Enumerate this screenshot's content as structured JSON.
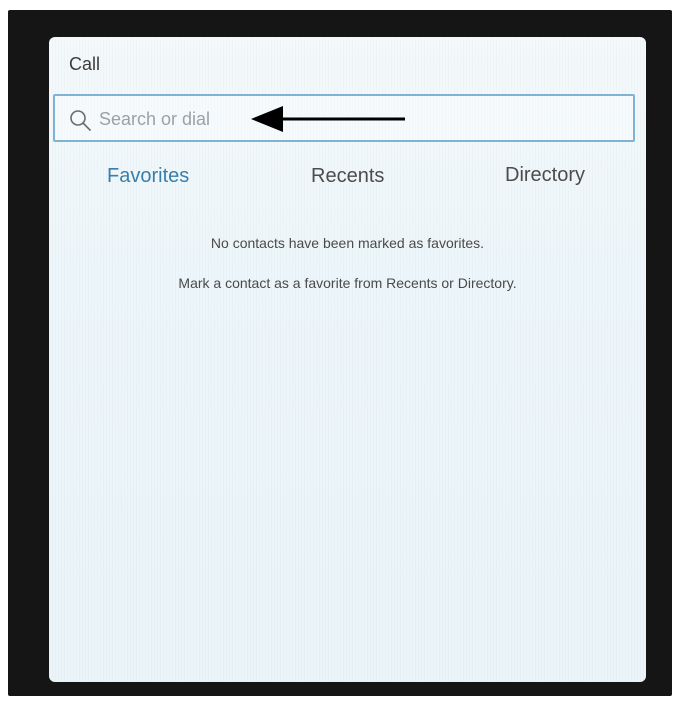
{
  "panel": {
    "title": "Call"
  },
  "search": {
    "placeholder": "Search or dial",
    "value": ""
  },
  "tabs": {
    "favorites": "Favorites",
    "recents": "Recents",
    "directory": "Directory",
    "active": "Favorites"
  },
  "favorites": {
    "empty_message": "No contacts have been marked as favorites.",
    "hint_message": "Mark a contact as a favorite from Recents or Directory."
  },
  "colors": {
    "active_tab": "#3a7fa8",
    "search_border": "#7fb3d6",
    "arrow": "#000000"
  },
  "icons": {
    "search": "search-icon",
    "annotation": "arrow-left-icon"
  }
}
